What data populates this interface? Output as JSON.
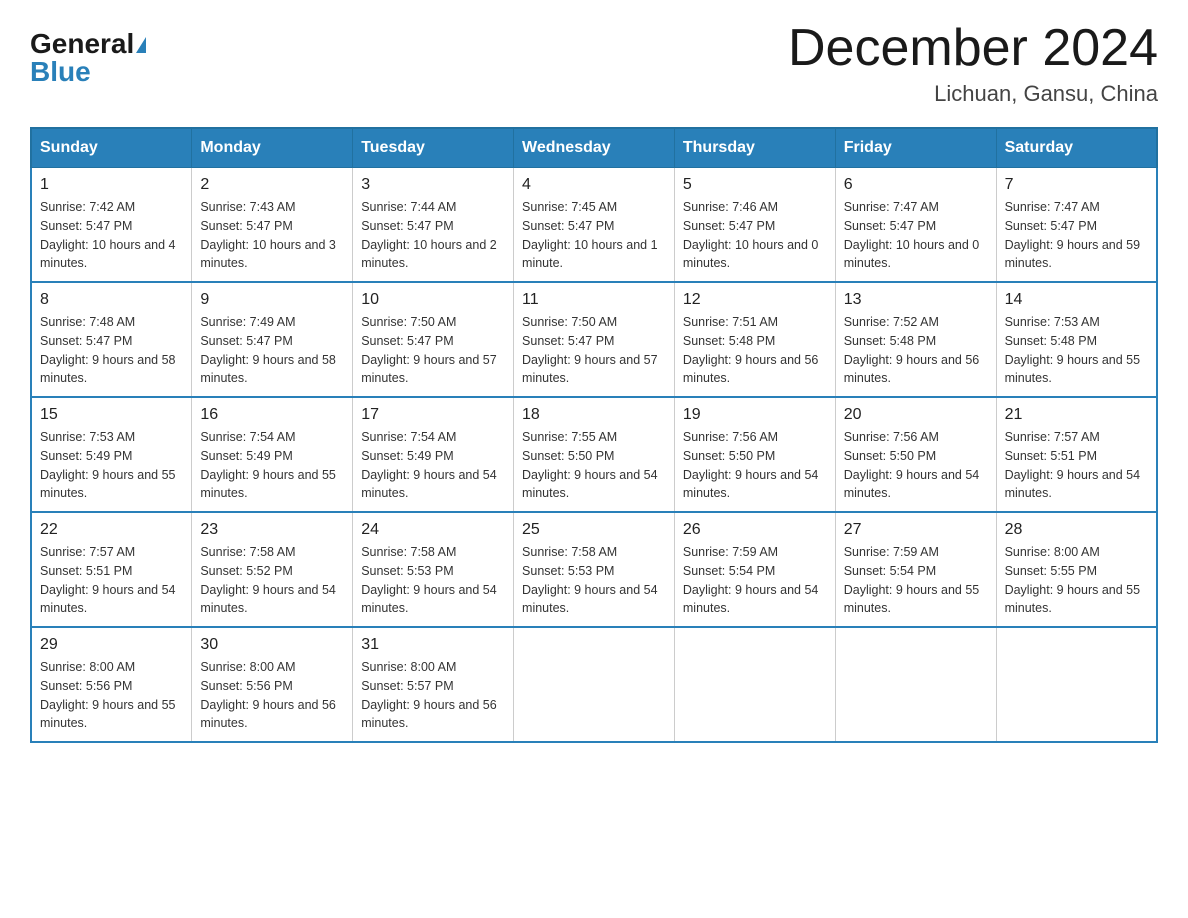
{
  "logo": {
    "general": "General",
    "blue": "Blue"
  },
  "title": "December 2024",
  "subtitle": "Lichuan, Gansu, China",
  "weekdays": [
    "Sunday",
    "Monday",
    "Tuesday",
    "Wednesday",
    "Thursday",
    "Friday",
    "Saturday"
  ],
  "weeks": [
    [
      {
        "day": "1",
        "sunrise": "7:42 AM",
        "sunset": "5:47 PM",
        "daylight": "10 hours and 4 minutes."
      },
      {
        "day": "2",
        "sunrise": "7:43 AM",
        "sunset": "5:47 PM",
        "daylight": "10 hours and 3 minutes."
      },
      {
        "day": "3",
        "sunrise": "7:44 AM",
        "sunset": "5:47 PM",
        "daylight": "10 hours and 2 minutes."
      },
      {
        "day": "4",
        "sunrise": "7:45 AM",
        "sunset": "5:47 PM",
        "daylight": "10 hours and 1 minute."
      },
      {
        "day": "5",
        "sunrise": "7:46 AM",
        "sunset": "5:47 PM",
        "daylight": "10 hours and 0 minutes."
      },
      {
        "day": "6",
        "sunrise": "7:47 AM",
        "sunset": "5:47 PM",
        "daylight": "10 hours and 0 minutes."
      },
      {
        "day": "7",
        "sunrise": "7:47 AM",
        "sunset": "5:47 PM",
        "daylight": "9 hours and 59 minutes."
      }
    ],
    [
      {
        "day": "8",
        "sunrise": "7:48 AM",
        "sunset": "5:47 PM",
        "daylight": "9 hours and 58 minutes."
      },
      {
        "day": "9",
        "sunrise": "7:49 AM",
        "sunset": "5:47 PM",
        "daylight": "9 hours and 58 minutes."
      },
      {
        "day": "10",
        "sunrise": "7:50 AM",
        "sunset": "5:47 PM",
        "daylight": "9 hours and 57 minutes."
      },
      {
        "day": "11",
        "sunrise": "7:50 AM",
        "sunset": "5:47 PM",
        "daylight": "9 hours and 57 minutes."
      },
      {
        "day": "12",
        "sunrise": "7:51 AM",
        "sunset": "5:48 PM",
        "daylight": "9 hours and 56 minutes."
      },
      {
        "day": "13",
        "sunrise": "7:52 AM",
        "sunset": "5:48 PM",
        "daylight": "9 hours and 56 minutes."
      },
      {
        "day": "14",
        "sunrise": "7:53 AM",
        "sunset": "5:48 PM",
        "daylight": "9 hours and 55 minutes."
      }
    ],
    [
      {
        "day": "15",
        "sunrise": "7:53 AM",
        "sunset": "5:49 PM",
        "daylight": "9 hours and 55 minutes."
      },
      {
        "day": "16",
        "sunrise": "7:54 AM",
        "sunset": "5:49 PM",
        "daylight": "9 hours and 55 minutes."
      },
      {
        "day": "17",
        "sunrise": "7:54 AM",
        "sunset": "5:49 PM",
        "daylight": "9 hours and 54 minutes."
      },
      {
        "day": "18",
        "sunrise": "7:55 AM",
        "sunset": "5:50 PM",
        "daylight": "9 hours and 54 minutes."
      },
      {
        "day": "19",
        "sunrise": "7:56 AM",
        "sunset": "5:50 PM",
        "daylight": "9 hours and 54 minutes."
      },
      {
        "day": "20",
        "sunrise": "7:56 AM",
        "sunset": "5:50 PM",
        "daylight": "9 hours and 54 minutes."
      },
      {
        "day": "21",
        "sunrise": "7:57 AM",
        "sunset": "5:51 PM",
        "daylight": "9 hours and 54 minutes."
      }
    ],
    [
      {
        "day": "22",
        "sunrise": "7:57 AM",
        "sunset": "5:51 PM",
        "daylight": "9 hours and 54 minutes."
      },
      {
        "day": "23",
        "sunrise": "7:58 AM",
        "sunset": "5:52 PM",
        "daylight": "9 hours and 54 minutes."
      },
      {
        "day": "24",
        "sunrise": "7:58 AM",
        "sunset": "5:53 PM",
        "daylight": "9 hours and 54 minutes."
      },
      {
        "day": "25",
        "sunrise": "7:58 AM",
        "sunset": "5:53 PM",
        "daylight": "9 hours and 54 minutes."
      },
      {
        "day": "26",
        "sunrise": "7:59 AM",
        "sunset": "5:54 PM",
        "daylight": "9 hours and 54 minutes."
      },
      {
        "day": "27",
        "sunrise": "7:59 AM",
        "sunset": "5:54 PM",
        "daylight": "9 hours and 55 minutes."
      },
      {
        "day": "28",
        "sunrise": "8:00 AM",
        "sunset": "5:55 PM",
        "daylight": "9 hours and 55 minutes."
      }
    ],
    [
      {
        "day": "29",
        "sunrise": "8:00 AM",
        "sunset": "5:56 PM",
        "daylight": "9 hours and 55 minutes."
      },
      {
        "day": "30",
        "sunrise": "8:00 AM",
        "sunset": "5:56 PM",
        "daylight": "9 hours and 56 minutes."
      },
      {
        "day": "31",
        "sunrise": "8:00 AM",
        "sunset": "5:57 PM",
        "daylight": "9 hours and 56 minutes."
      },
      null,
      null,
      null,
      null
    ]
  ],
  "labels": {
    "sunrise": "Sunrise:",
    "sunset": "Sunset:",
    "daylight": "Daylight:"
  }
}
